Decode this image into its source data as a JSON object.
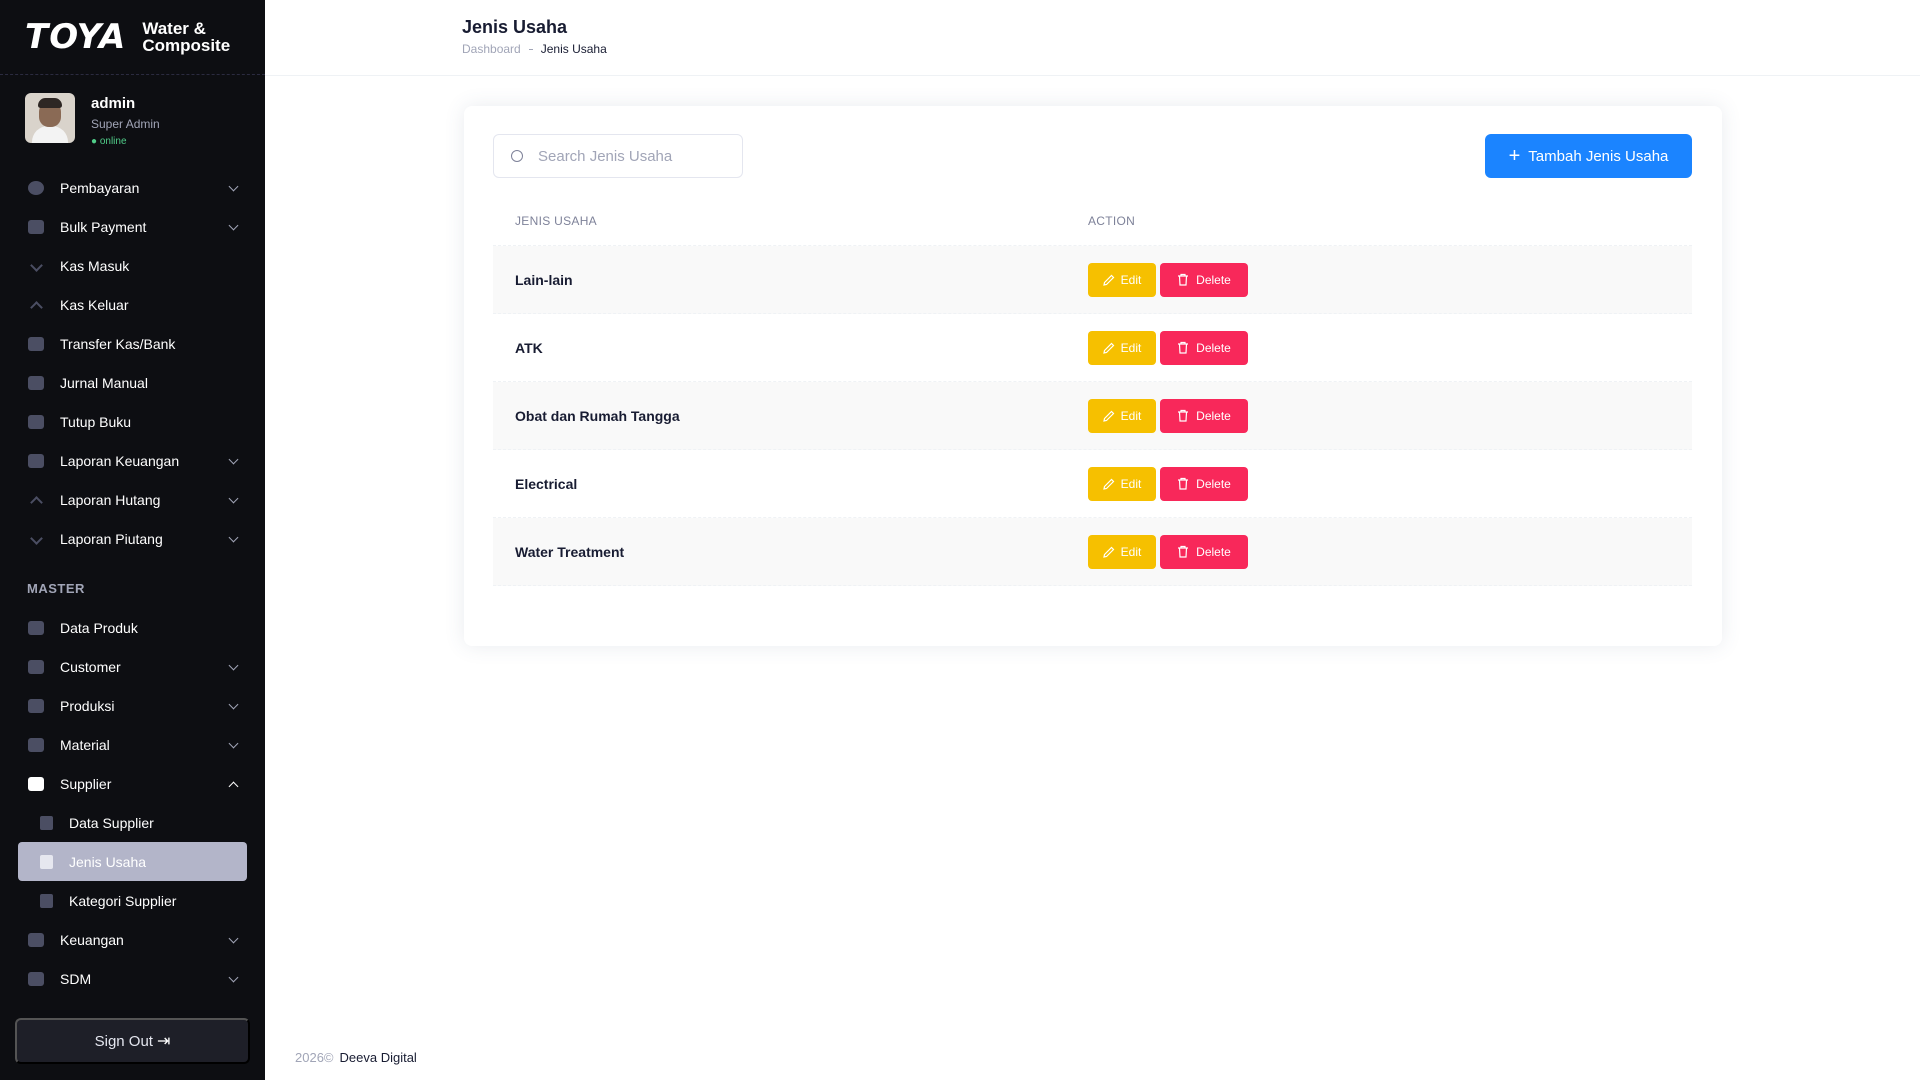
{
  "brand": {
    "logo": "TOYA",
    "subtitle_line1": "Water &",
    "subtitle_line2": "Composite"
  },
  "user": {
    "name": "admin",
    "role": "Super Admin",
    "status": "● online"
  },
  "sidebar": {
    "items_top": [
      {
        "label": "Pembayaran",
        "icon": "payment-icon",
        "has_chevron": true
      },
      {
        "label": "Bulk Payment",
        "icon": "bulk-payment-icon",
        "has_chevron": true
      },
      {
        "label": "Kas Masuk",
        "icon": "arrow-down-icon",
        "has_chevron": false
      },
      {
        "label": "Kas Keluar",
        "icon": "arrow-up-icon",
        "has_chevron": false
      },
      {
        "label": "Transfer Kas/Bank",
        "icon": "transfer-icon",
        "has_chevron": false
      },
      {
        "label": "Jurnal Manual",
        "icon": "journal-icon",
        "has_chevron": false
      },
      {
        "label": "Tutup Buku",
        "icon": "book-icon",
        "has_chevron": false
      },
      {
        "label": "Laporan Keuangan",
        "icon": "chart-icon",
        "has_chevron": true
      },
      {
        "label": "Laporan Hutang",
        "icon": "arrow-up-icon",
        "has_chevron": true
      },
      {
        "label": "Laporan Piutang",
        "icon": "arrow-down-icon",
        "has_chevron": true
      }
    ],
    "section_master": "MASTER",
    "items_master": [
      {
        "label": "Data Produk",
        "icon": "file-icon",
        "has_chevron": false
      },
      {
        "label": "Customer",
        "icon": "box-icon",
        "has_chevron": true
      },
      {
        "label": "Produksi",
        "icon": "box-icon",
        "has_chevron": true
      },
      {
        "label": "Material",
        "icon": "box-icon",
        "has_chevron": true
      },
      {
        "label": "Supplier",
        "icon": "box-icon",
        "has_chevron": true,
        "open": true
      }
    ],
    "supplier_sub": [
      {
        "label": "Data Supplier",
        "active": false
      },
      {
        "label": "Jenis Usaha",
        "active": true
      },
      {
        "label": "Kategori Supplier",
        "active": false
      }
    ],
    "items_bottom": [
      {
        "label": "Keuangan",
        "icon": "box-icon",
        "has_chevron": true
      },
      {
        "label": "SDM",
        "icon": "box-icon",
        "has_chevron": true
      }
    ],
    "signout_label": "Sign Out"
  },
  "header": {
    "title": "Jenis Usaha",
    "breadcrumb_home": "Dashboard",
    "breadcrumb_current": "Jenis Usaha"
  },
  "toolbar": {
    "search_placeholder": "Search Jenis Usaha",
    "search_value": "",
    "add_label": "Tambah Jenis Usaha"
  },
  "table": {
    "columns": [
      "JENIS USAHA",
      "ACTION"
    ],
    "rows": [
      {
        "name": "Lain-lain"
      },
      {
        "name": "ATK"
      },
      {
        "name": "Obat dan Rumah Tangga"
      },
      {
        "name": "Electrical"
      },
      {
        "name": "Water Treatment"
      }
    ],
    "edit_label": "Edit",
    "delete_label": "Delete"
  },
  "footer": {
    "year": "2026©",
    "company": "Deeva Digital"
  },
  "colors": {
    "sidebar_bg": "#0d0e12",
    "primary": "#1b84ff",
    "warning": "#f6c000",
    "danger": "#f8285a",
    "active_item": "#b3b5c9"
  }
}
